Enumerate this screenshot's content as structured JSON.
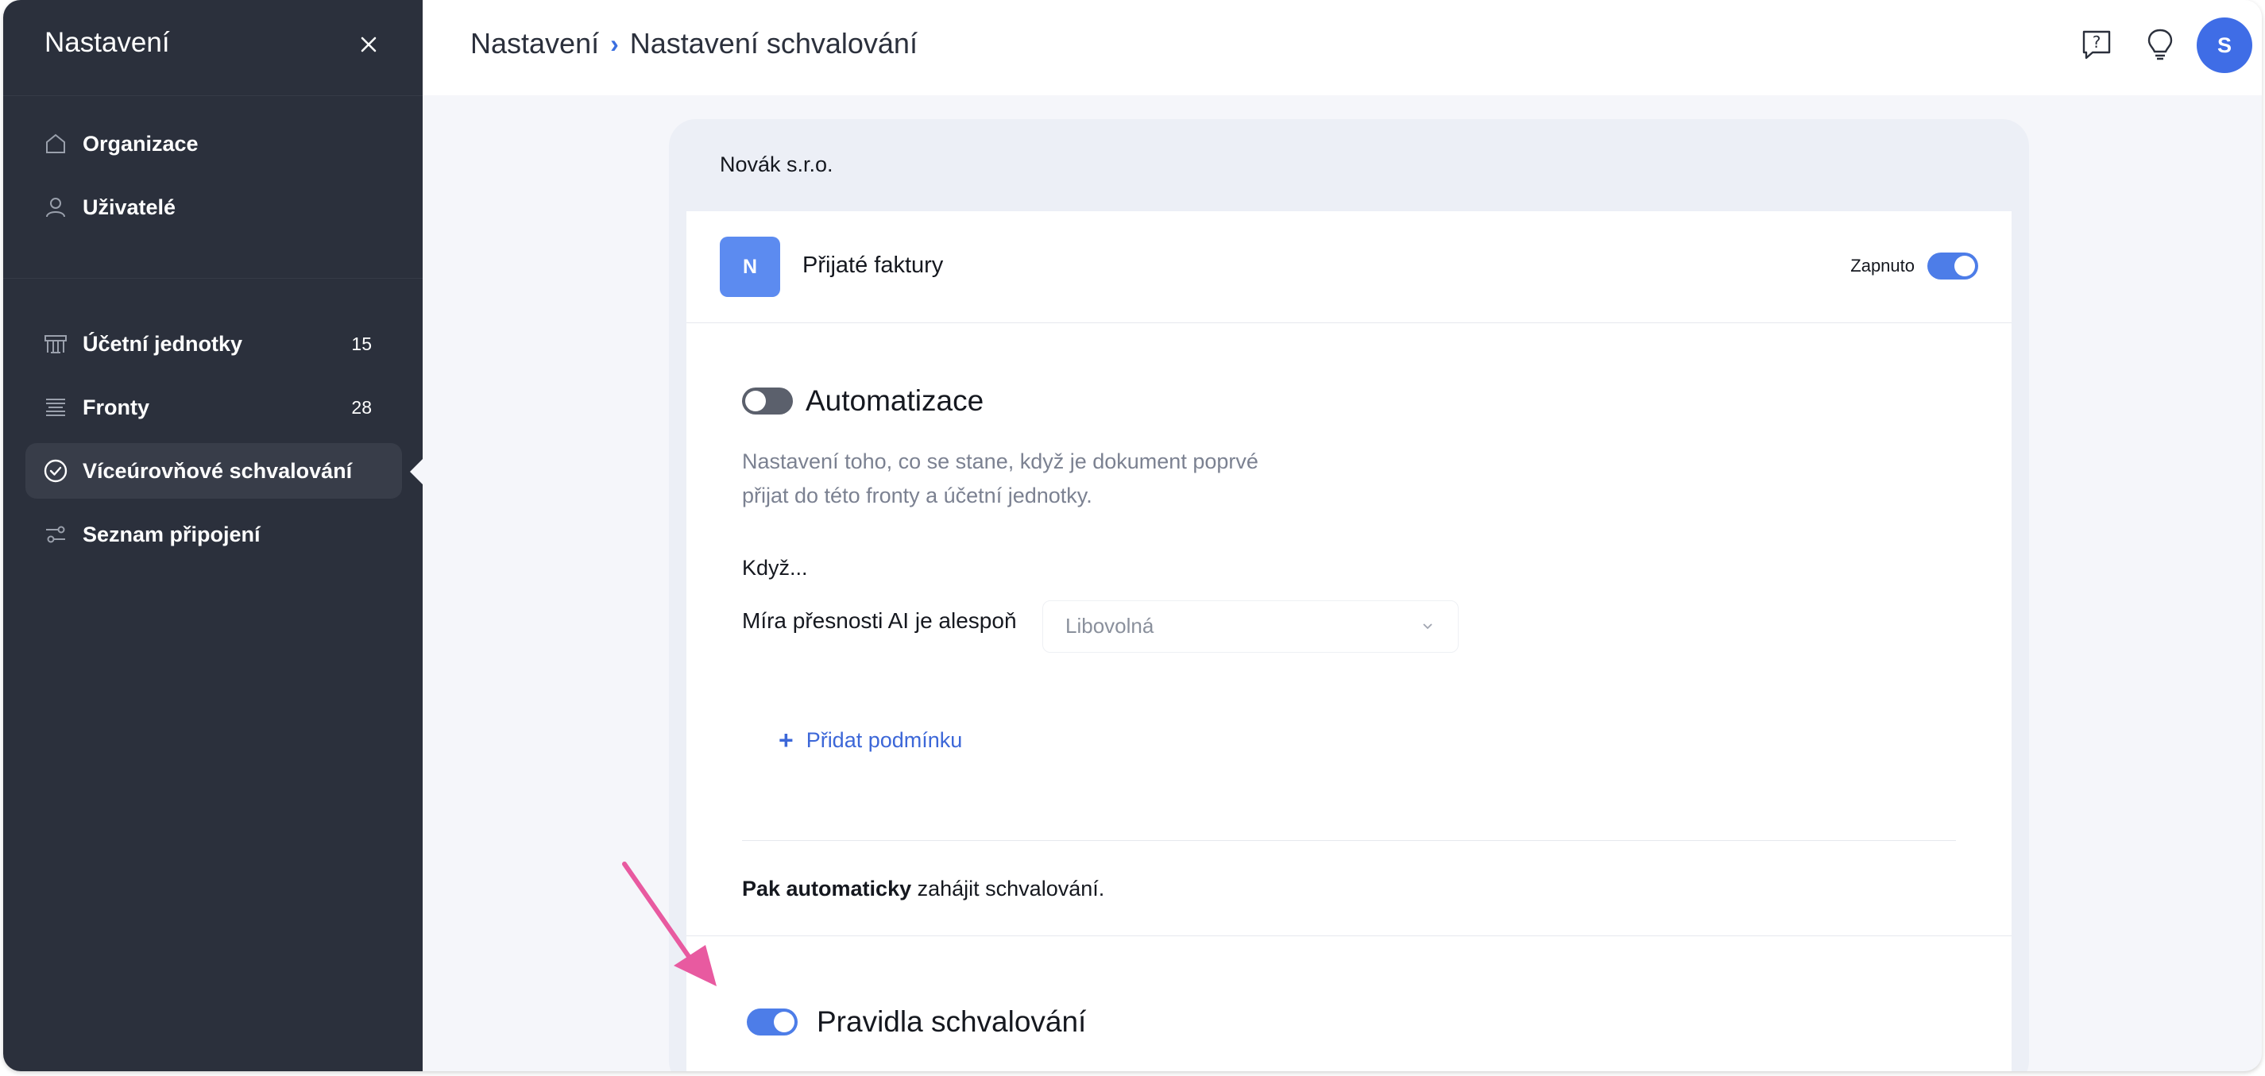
{
  "sidebar": {
    "title": "Nastavení",
    "items": [
      {
        "label": "Organizace",
        "icon": "home-icon",
        "count": ""
      },
      {
        "label": "Uživatelé",
        "icon": "user-icon",
        "count": ""
      },
      {
        "label": "Účetní jednotky",
        "icon": "building-icon",
        "count": "15"
      },
      {
        "label": "Fronty",
        "icon": "queue-icon",
        "count": "28"
      },
      {
        "label": "Víceúrovňové schvalování",
        "icon": "check-circle-icon",
        "count": "",
        "active": true
      },
      {
        "label": "Seznam připojení",
        "icon": "connections-icon",
        "count": ""
      }
    ]
  },
  "header": {
    "breadcrumb": [
      "Nastavení",
      "Nastavení schvalování"
    ],
    "avatar_initial": "S",
    "icons": [
      "help-icon",
      "lightbulb-icon"
    ]
  },
  "card": {
    "organization": "Novák s.r.o.",
    "queue": {
      "badge": "N",
      "title": "Přijaté faktury",
      "status_label": "Zapnuto",
      "enabled": true
    },
    "automation": {
      "title": "Automatizace",
      "enabled": false,
      "description_line1": "Nastavení toho, co se stane, když je dokument poprvé",
      "description_line2": "přijat do této fronty a účetní jednotky.",
      "when_label": "Když...",
      "accuracy_label": "Míra přesnosti AI je alespoň",
      "accuracy_value": "Libovolná",
      "add_condition": "Přidat podmínku",
      "then_bold": "Pak automaticky",
      "then_rest": " zahájit schvalování."
    },
    "approval_rules": {
      "title": "Pravidla schvalování",
      "enabled": true
    }
  },
  "colors": {
    "sidebar_bg": "#2b303c",
    "accent": "#4d7de8",
    "link": "#3c67d8",
    "arrow": "#e85aa0"
  }
}
